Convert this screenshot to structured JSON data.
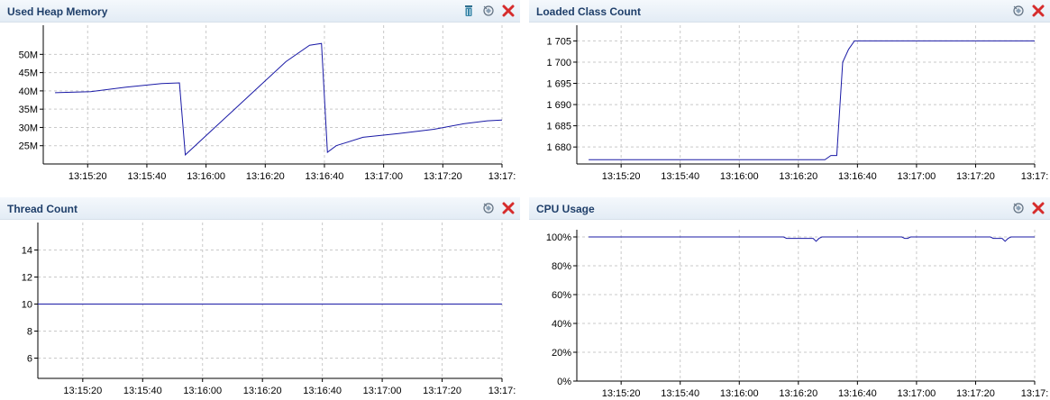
{
  "panels": [
    {
      "id": "heap",
      "title": "Used Heap Memory",
      "icons": [
        "trash-icon",
        "gc-icon",
        "close-icon"
      ],
      "chart_data": {
        "type": "line",
        "title": "Used Heap Memory",
        "x_ticks": [
          "13:15:20",
          "13:15:40",
          "13:16:00",
          "13:16:20",
          "13:16:40",
          "13:17:00",
          "13:17:20",
          "13:17:"
        ],
        "y_ticks": [
          "50M",
          "45M",
          "40M",
          "35M",
          "30M",
          "25M"
        ],
        "ylim": [
          20,
          56
        ],
        "xlim": [
          0,
          155
        ],
        "grid": true,
        "x": [
          4,
          16,
          28,
          40,
          46,
          48,
          58,
          70,
          82,
          90,
          94,
          96,
          99,
          108,
          120,
          132,
          142,
          150,
          155
        ],
        "values": [
          39.5,
          39.8,
          41,
          42,
          42.2,
          22.5,
          30,
          39,
          48,
          52.5,
          53,
          23.2,
          25,
          27.3,
          28.3,
          29.5,
          31,
          31.8,
          32
        ]
      }
    },
    {
      "id": "classes",
      "title": "Loaded Class Count",
      "icons": [
        "gc-icon",
        "close-icon"
      ],
      "chart_data": {
        "type": "line",
        "title": "Loaded Class Count",
        "x_ticks": [
          "13:15:20",
          "13:15:40",
          "13:16:00",
          "13:16:20",
          "13:16:40",
          "13:17:00",
          "13:17:20",
          "13:17:"
        ],
        "y_ticks": [
          "1 705",
          "1 700",
          "1 695",
          "1 690",
          "1 685",
          "1 680"
        ],
        "ylim": [
          1676,
          1707
        ],
        "xlim": [
          0,
          155
        ],
        "grid": true,
        "x": [
          4,
          80,
          84,
          86,
          88,
          90,
          92,
          94,
          155
        ],
        "values": [
          1677,
          1677,
          1677,
          1678,
          1678,
          1700,
          1703,
          1705,
          1705
        ]
      }
    },
    {
      "id": "threads",
      "title": "Thread Count",
      "icons": [
        "gc-icon",
        "close-icon"
      ],
      "chart_data": {
        "type": "line",
        "title": "Thread Count",
        "x_ticks": [
          "13:15:20",
          "13:15:40",
          "13:16:00",
          "13:16:20",
          "13:16:40",
          "13:17:00",
          "13:17:20",
          "13:17:"
        ],
        "y_ticks": [
          "14",
          "12",
          "10",
          "8",
          "6"
        ],
        "ylim": [
          4.5,
          15.5
        ],
        "xlim": [
          0,
          155
        ],
        "grid": true,
        "x": [
          0,
          155
        ],
        "values": [
          10,
          10
        ]
      }
    },
    {
      "id": "cpu",
      "title": "CPU Usage",
      "icons": [
        "gc-icon",
        "close-icon"
      ],
      "chart_data": {
        "type": "line",
        "title": "CPU Usage",
        "x_ticks": [
          "13:15:20",
          "13:15:40",
          "13:16:00",
          "13:16:20",
          "13:16:40",
          "13:17:00",
          "13:17:20",
          "13:17:"
        ],
        "y_ticks": [
          "100%",
          "80%",
          "60%",
          "40%",
          "20%",
          "0%"
        ],
        "ylim": [
          0,
          100
        ],
        "xlim": [
          0,
          155
        ],
        "grid": true,
        "x": [
          4,
          70,
          71,
          80,
          81,
          82,
          83,
          84,
          110,
          111,
          112,
          113,
          140,
          141,
          144,
          145,
          146,
          147,
          148,
          155
        ],
        "values": [
          100,
          100,
          99,
          99,
          97,
          99,
          100,
          100,
          100,
          99,
          99,
          100,
          100,
          99,
          99,
          97,
          99,
          100,
          100,
          100
        ]
      }
    }
  ]
}
